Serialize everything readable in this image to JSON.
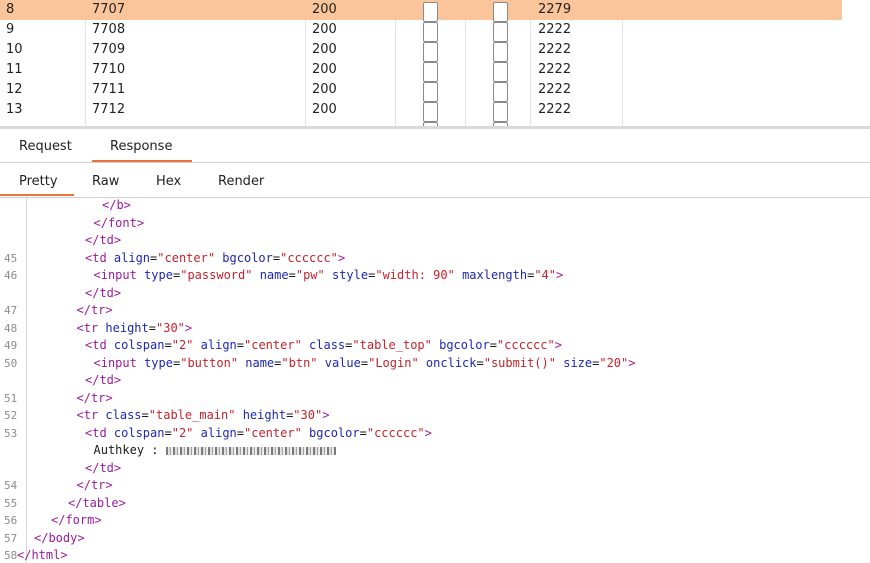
{
  "results": {
    "rows": [
      {
        "num": "8",
        "payload": "7707",
        "status": "200",
        "length": "2279",
        "selected": true
      },
      {
        "num": "9",
        "payload": "7708",
        "status": "200",
        "length": "2222",
        "selected": false
      },
      {
        "num": "10",
        "payload": "7709",
        "status": "200",
        "length": "2222",
        "selected": false
      },
      {
        "num": "11",
        "payload": "7710",
        "status": "200",
        "length": "2222",
        "selected": false
      },
      {
        "num": "12",
        "payload": "7711",
        "status": "200",
        "length": "2222",
        "selected": false
      },
      {
        "num": "13",
        "payload": "7712",
        "status": "200",
        "length": "2222",
        "selected": false
      }
    ]
  },
  "tabs": {
    "request": "Request",
    "response": "Response",
    "pretty": "Pretty",
    "raw": "Raw",
    "hex": "Hex",
    "render": "Render"
  },
  "editor": {
    "lines": [
      {
        "ln": "",
        "parts": [
          [
            "tag",
            "</b>"
          ]
        ],
        "indent": 10
      },
      {
        "ln": "",
        "parts": [
          [
            "tag",
            "</font>"
          ]
        ],
        "indent": 9
      },
      {
        "ln": "",
        "parts": [
          [
            "tag",
            "</td>"
          ]
        ],
        "indent": 8
      },
      {
        "ln": "45",
        "parts": [
          [
            "tag",
            "<td "
          ],
          [
            "attr",
            "align"
          ],
          [
            "txt",
            "="
          ],
          [
            "val",
            "\"center\""
          ],
          [
            "txt",
            " "
          ],
          [
            "attr",
            "bgcolor"
          ],
          [
            "txt",
            "="
          ],
          [
            "val",
            "\"cccccc\""
          ],
          [
            "tag",
            ">"
          ]
        ],
        "indent": 8
      },
      {
        "ln": "46",
        "parts": [
          [
            "tag",
            "<input "
          ],
          [
            "attr",
            "type"
          ],
          [
            "txt",
            "="
          ],
          [
            "val",
            "\"password\""
          ],
          [
            "txt",
            " "
          ],
          [
            "attr",
            "name"
          ],
          [
            "txt",
            "="
          ],
          [
            "val",
            "\"pw\""
          ],
          [
            "txt",
            " "
          ],
          [
            "attr",
            "style"
          ],
          [
            "txt",
            "="
          ],
          [
            "val",
            "\"width: 90\""
          ],
          [
            "txt",
            " "
          ],
          [
            "attr",
            "maxlength"
          ],
          [
            "txt",
            "="
          ],
          [
            "val",
            "\"4\""
          ],
          [
            "tag",
            ">"
          ]
        ],
        "indent": 9
      },
      {
        "ln": "",
        "parts": [
          [
            "tag",
            "</td>"
          ]
        ],
        "indent": 8
      },
      {
        "ln": "47",
        "parts": [
          [
            "tag",
            "</tr>"
          ]
        ],
        "indent": 7
      },
      {
        "ln": "48",
        "parts": [
          [
            "tag",
            "<tr "
          ],
          [
            "attr",
            "height"
          ],
          [
            "txt",
            "="
          ],
          [
            "val",
            "\"30\""
          ],
          [
            "tag",
            ">"
          ]
        ],
        "indent": 7
      },
      {
        "ln": "49",
        "parts": [
          [
            "tag",
            "<td "
          ],
          [
            "attr",
            "colspan"
          ],
          [
            "txt",
            "="
          ],
          [
            "val",
            "\"2\""
          ],
          [
            "txt",
            " "
          ],
          [
            "attr",
            "align"
          ],
          [
            "txt",
            "="
          ],
          [
            "val",
            "\"center\""
          ],
          [
            "txt",
            " "
          ],
          [
            "attr",
            "class"
          ],
          [
            "txt",
            "="
          ],
          [
            "val",
            "\"table_top\""
          ],
          [
            "txt",
            " "
          ],
          [
            "attr",
            "bgcolor"
          ],
          [
            "txt",
            "="
          ],
          [
            "val",
            "\"cccccc\""
          ],
          [
            "tag",
            ">"
          ]
        ],
        "indent": 8
      },
      {
        "ln": "50",
        "parts": [
          [
            "tag",
            "<input "
          ],
          [
            "attr",
            "type"
          ],
          [
            "txt",
            "="
          ],
          [
            "val",
            "\"button\""
          ],
          [
            "txt",
            " "
          ],
          [
            "attr",
            "name"
          ],
          [
            "txt",
            "="
          ],
          [
            "val",
            "\"btn\""
          ],
          [
            "txt",
            " "
          ],
          [
            "attr",
            "value"
          ],
          [
            "txt",
            "="
          ],
          [
            "val",
            "\"Login\""
          ],
          [
            "txt",
            " "
          ],
          [
            "attr",
            "onclick"
          ],
          [
            "txt",
            "="
          ],
          [
            "val",
            "\"submit()\""
          ],
          [
            "txt",
            " "
          ],
          [
            "attr",
            "size"
          ],
          [
            "txt",
            "="
          ],
          [
            "val",
            "\"20\""
          ],
          [
            "tag",
            ">"
          ]
        ],
        "indent": 9
      },
      {
        "ln": "",
        "parts": [
          [
            "tag",
            "</td>"
          ]
        ],
        "indent": 8
      },
      {
        "ln": "51",
        "parts": [
          [
            "tag",
            "</tr>"
          ]
        ],
        "indent": 7
      },
      {
        "ln": "52",
        "parts": [
          [
            "tag",
            "<tr "
          ],
          [
            "attr",
            "class"
          ],
          [
            "txt",
            "="
          ],
          [
            "val",
            "\"table_main\""
          ],
          [
            "txt",
            " "
          ],
          [
            "attr",
            "height"
          ],
          [
            "txt",
            "="
          ],
          [
            "val",
            "\"30\""
          ],
          [
            "tag",
            ">"
          ]
        ],
        "indent": 7
      },
      {
        "ln": "53",
        "parts": [
          [
            "tag",
            "<td "
          ],
          [
            "attr",
            "colspan"
          ],
          [
            "txt",
            "="
          ],
          [
            "val",
            "\"2\""
          ],
          [
            "txt",
            " "
          ],
          [
            "attr",
            "align"
          ],
          [
            "txt",
            "="
          ],
          [
            "val",
            "\"center\""
          ],
          [
            "txt",
            " "
          ],
          [
            "attr",
            "bgcolor"
          ],
          [
            "txt",
            "="
          ],
          [
            "val",
            "\"cccccc\""
          ],
          [
            "tag",
            ">"
          ]
        ],
        "indent": 8
      },
      {
        "ln": "",
        "parts": [
          [
            "txt",
            "Authkey : "
          ],
          [
            "blur",
            ""
          ]
        ],
        "indent": 9
      },
      {
        "ln": "",
        "parts": [
          [
            "tag",
            "</td>"
          ]
        ],
        "indent": 8
      },
      {
        "ln": "54",
        "parts": [
          [
            "tag",
            "</tr>"
          ]
        ],
        "indent": 7
      },
      {
        "ln": "55",
        "parts": [
          [
            "tag",
            "</table>"
          ]
        ],
        "indent": 6
      },
      {
        "ln": "56",
        "parts": [
          [
            "tag",
            "</form>"
          ]
        ],
        "indent": 4
      },
      {
        "ln": "57",
        "parts": [
          [
            "tag",
            "</body>"
          ]
        ],
        "indent": 2
      },
      {
        "ln": "58",
        "parts": [
          [
            "tag",
            "</html>"
          ]
        ],
        "indent": 0
      }
    ]
  }
}
